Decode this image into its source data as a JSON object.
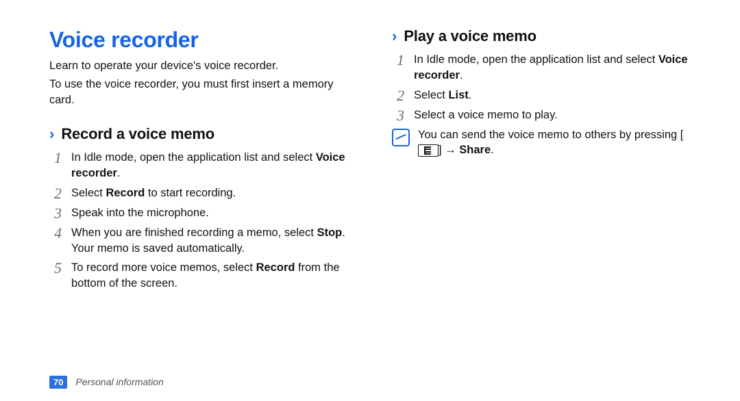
{
  "title": "Voice recorder",
  "intro": [
    "Learn to operate your device's voice recorder.",
    "To use the voice recorder, you must first insert a memory card."
  ],
  "sections": {
    "record": {
      "heading": "Record a voice memo",
      "steps": [
        {
          "num": "1",
          "html": "In Idle mode, open the application list and select <b>Voice recorder</b>."
        },
        {
          "num": "2",
          "html": "Select <b>Record</b> to start recording."
        },
        {
          "num": "3",
          "html": "Speak into the microphone."
        },
        {
          "num": "4",
          "html": "When you are finished recording a memo, select <b>Stop</b>. Your memo is saved automatically."
        },
        {
          "num": "5",
          "html": "To record more voice memos, select <b>Record</b> from the bottom of the screen."
        }
      ]
    },
    "play": {
      "heading": "Play a voice memo",
      "steps": [
        {
          "num": "1",
          "html": "In Idle mode, open the application list and select <b>Voice recorder</b>."
        },
        {
          "num": "2",
          "html": "Select <b>List</b>."
        },
        {
          "num": "3",
          "html": "Select a voice memo to play."
        }
      ],
      "note": {
        "prefix": "You can send the voice memo to others by pressing [",
        "suffix": "] → ",
        "bold": "Share",
        "end": "."
      }
    }
  },
  "footer": {
    "page": "70",
    "section": "Personal information"
  }
}
